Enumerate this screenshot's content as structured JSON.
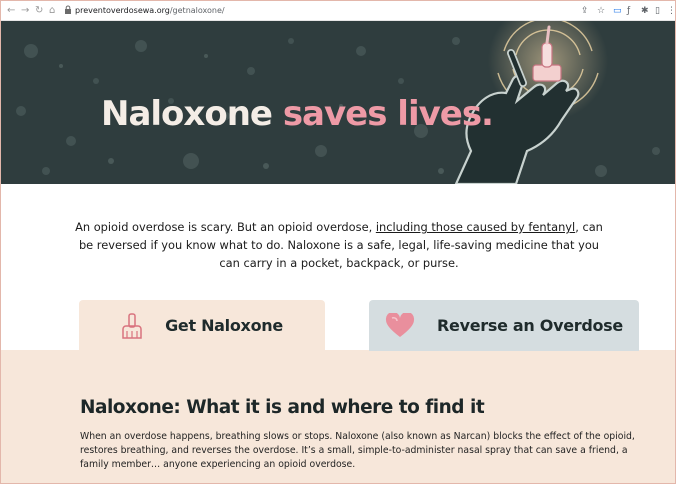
{
  "browser": {
    "url_host": "preventoverdosewa.org",
    "url_path": "/getnaloxone/"
  },
  "hero": {
    "title_main": "Naloxone ",
    "title_accent": "saves lives."
  },
  "intro": {
    "text_before_link": "An opioid overdose is scary. But an opioid overdose, ",
    "link_text": "including those caused by fentanyl",
    "text_after_link": ", can be reversed if you know what to do. Naloxone is a safe, legal, life-saving medicine that you can carry in a pocket, backpack, or purse."
  },
  "tabs": [
    {
      "label": "Get Naloxone",
      "icon": "nasal-spray-icon"
    },
    {
      "label": "Reverse an Overdose",
      "icon": "heart-icon"
    }
  ],
  "section": {
    "title": "Naloxone: What it is and where to find it",
    "body": "When an overdose happens, breathing slows or stops. Naloxone (also known as Narcan) blocks the effect of the opioid, restores breathing, and reverses the overdose. It’s a small, simple-to-administer nasal spray that can save a friend, a family member… anyone experiencing an opioid overdose."
  },
  "colors": {
    "hero_bg": "#2f3d3e",
    "accent_pink": "#ee9aa6",
    "cream": "#f7e7da",
    "tab_blue_grey": "#d5dde0"
  }
}
